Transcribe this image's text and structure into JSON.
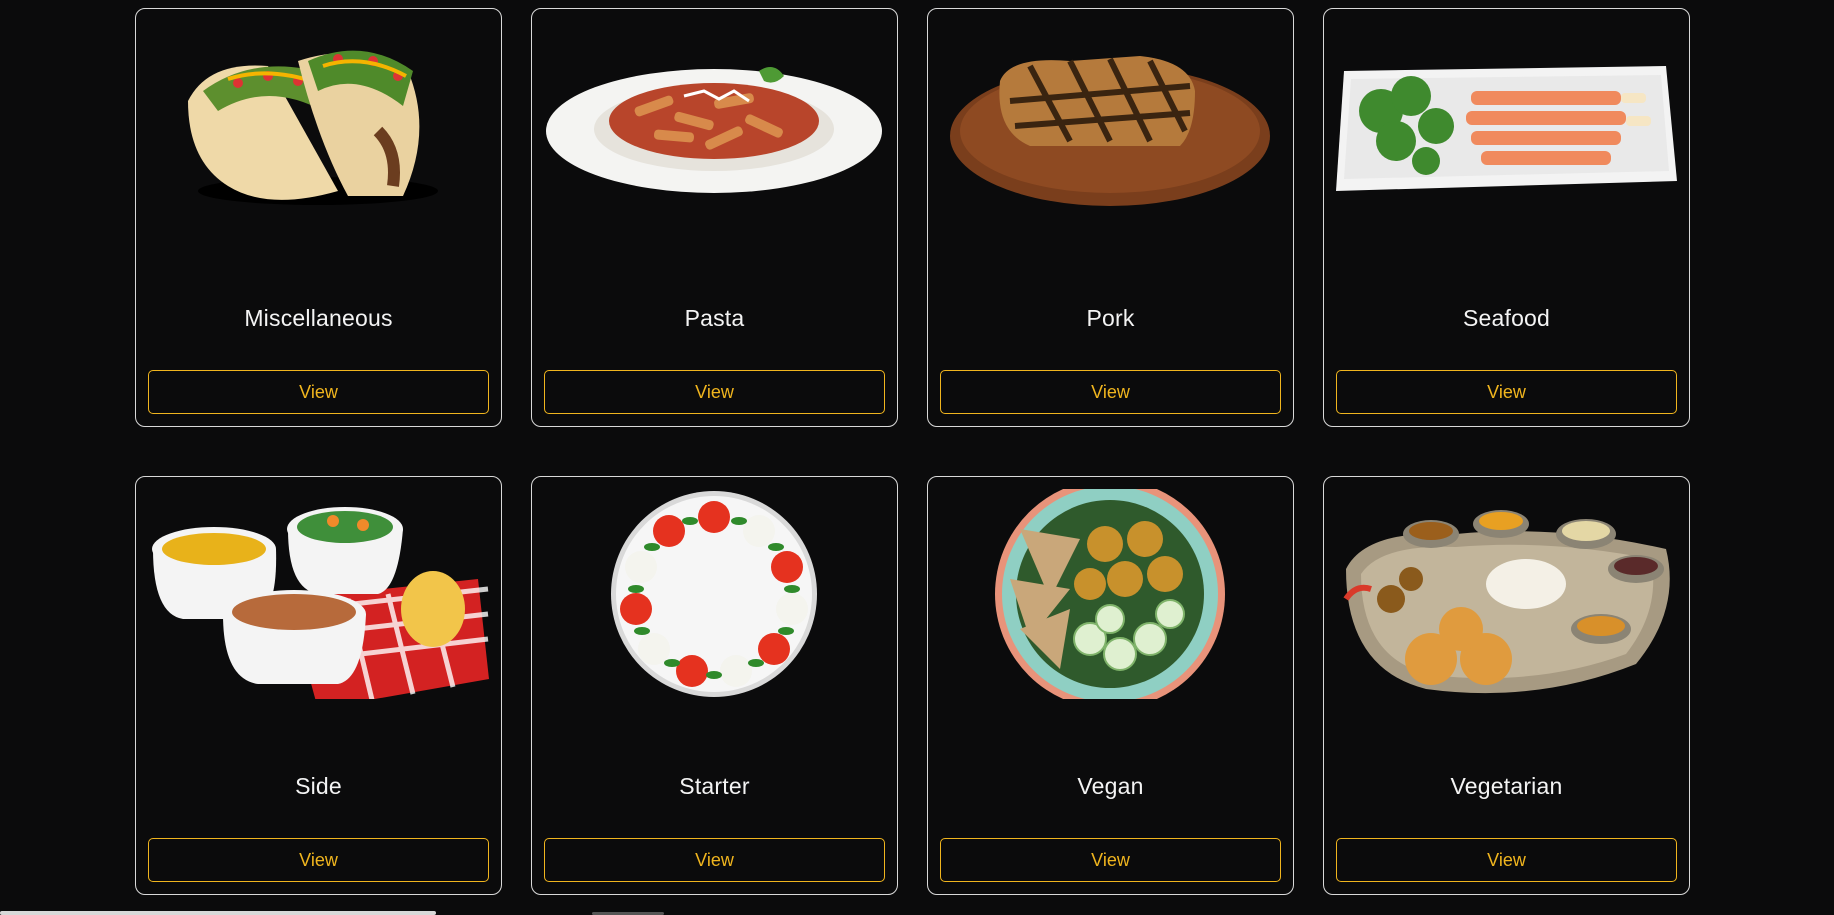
{
  "categories": [
    {
      "name": "Miscellaneous",
      "button": "View",
      "image": "tacos-image"
    },
    {
      "name": "Pasta",
      "button": "View",
      "image": "penne-pasta-image"
    },
    {
      "name": "Pork",
      "button": "View",
      "image": "grilled-pork-chop-image"
    },
    {
      "name": "Seafood",
      "button": "View",
      "image": "smoked-salmon-plate-image"
    },
    {
      "name": "Side",
      "button": "View",
      "image": "side-dishes-image"
    },
    {
      "name": "Starter",
      "button": "View",
      "image": "caprese-salad-image"
    },
    {
      "name": "Vegan",
      "button": "View",
      "image": "vegan-bowl-image"
    },
    {
      "name": "Vegetarian",
      "button": "View",
      "image": "thali-platter-image"
    }
  ],
  "colors": {
    "accent": "#f0b51e",
    "background": "#0b0b0c",
    "card_border": "#d9d9d9"
  }
}
